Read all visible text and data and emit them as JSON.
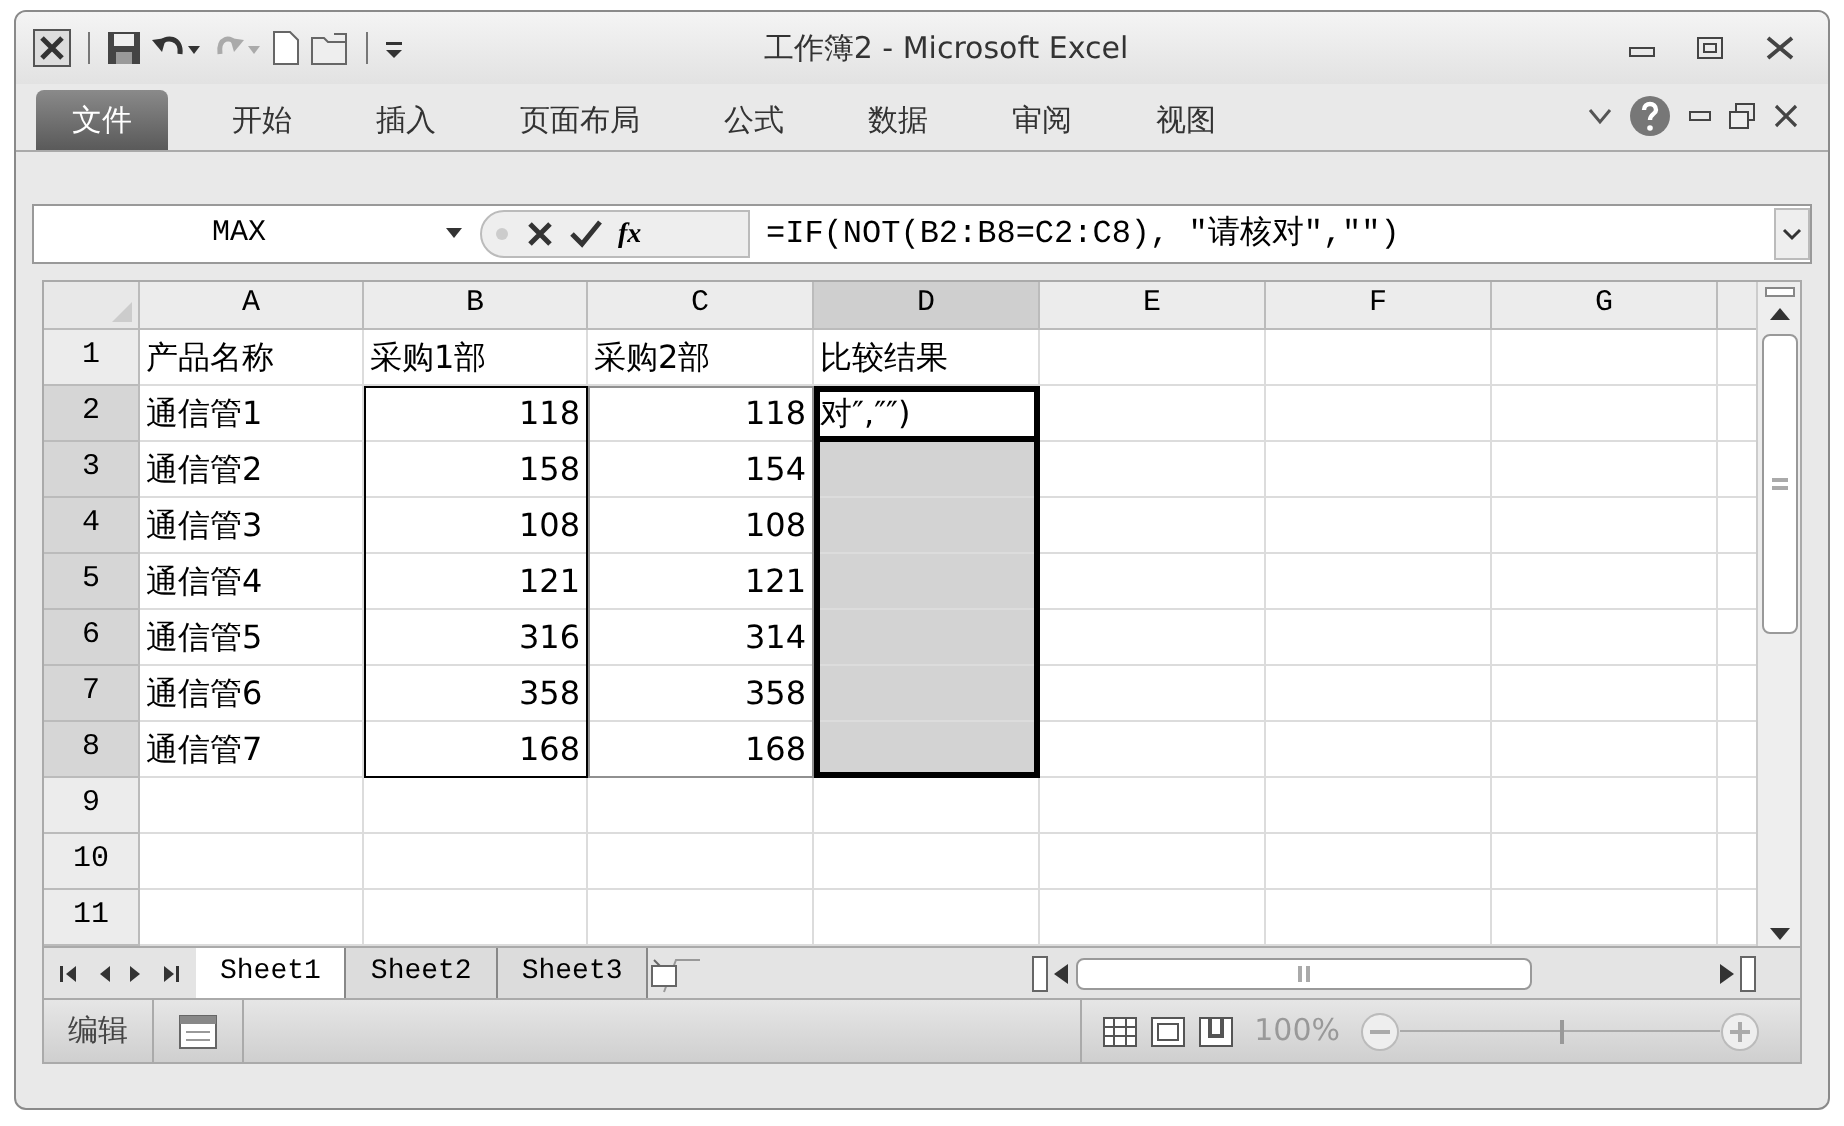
{
  "window": {
    "title": "工作簿2 - Microsoft Excel"
  },
  "ribbon_tabs": [
    {
      "label": "文件",
      "kind": "file",
      "selected": false
    },
    {
      "label": "开始",
      "kind": "tab",
      "selected": false
    },
    {
      "label": "插入",
      "kind": "tab",
      "selected": false
    },
    {
      "label": "页面布局",
      "kind": "tab",
      "selected": false
    },
    {
      "label": "公式",
      "kind": "tab",
      "selected": false
    },
    {
      "label": "数据",
      "kind": "tab",
      "selected": false
    },
    {
      "label": "审阅",
      "kind": "tab",
      "selected": false
    },
    {
      "label": "视图",
      "kind": "tab",
      "selected": false
    }
  ],
  "formula_bar": {
    "name_box": "MAX",
    "fx": "fx",
    "formula": "=IF(NOT(B2:B8=C2:C8), ″请核对″,″″)"
  },
  "sheet": {
    "columns": [
      {
        "label": "A",
        "kind": "text",
        "selected": false
      },
      {
        "label": "B",
        "kind": "number",
        "selected": false,
        "color": "#000000"
      },
      {
        "label": "C",
        "kind": "number",
        "selected": false,
        "color": "#909090"
      },
      {
        "label": "D",
        "kind": "text",
        "selected": true
      },
      {
        "label": "E",
        "kind": "text",
        "selected": false
      },
      {
        "label": "F",
        "kind": "text",
        "selected": false
      },
      {
        "label": "G",
        "kind": "text",
        "selected": false
      }
    ],
    "rows": [
      {
        "label": "1",
        "selected": false,
        "active": false,
        "cells": [
          "产品名称",
          "采购1部",
          "采购2部",
          "比较结果"
        ]
      },
      {
        "label": "2",
        "selected": true,
        "active": true,
        "cells": [
          "通信管1",
          "118",
          "118",
          "对″,″″)"
        ]
      },
      {
        "label": "3",
        "selected": true,
        "active": false,
        "cells": [
          "通信管2",
          "158",
          "154"
        ]
      },
      {
        "label": "4",
        "selected": true,
        "active": false,
        "cells": [
          "通信管3",
          "108",
          "108"
        ]
      },
      {
        "label": "5",
        "selected": true,
        "active": false,
        "cells": [
          "通信管4",
          "121",
          "121"
        ]
      },
      {
        "label": "6",
        "selected": true,
        "active": false,
        "cells": [
          "通信管5",
          "316",
          "314"
        ]
      },
      {
        "label": "7",
        "selected": true,
        "active": false,
        "cells": [
          "通信管6",
          "358",
          "358"
        ]
      },
      {
        "label": "8",
        "selected": true,
        "active": false,
        "cells": [
          "通信管7",
          "168",
          "168"
        ]
      },
      {
        "label": "9",
        "selected": false,
        "active": false,
        "cells": []
      },
      {
        "label": "10",
        "selected": false,
        "active": false,
        "cells": []
      },
      {
        "label": "11",
        "selected": false,
        "active": false,
        "cells": []
      }
    ]
  },
  "sheet_tabs": [
    {
      "label": "Sheet1",
      "selected": true
    },
    {
      "label": "Sheet2",
      "selected": false
    },
    {
      "label": "Sheet3",
      "selected": false
    }
  ],
  "status_bar": {
    "mode": "编辑",
    "zoom": "100%",
    "zoom_slider": {
      "level": 0.5
    }
  }
}
